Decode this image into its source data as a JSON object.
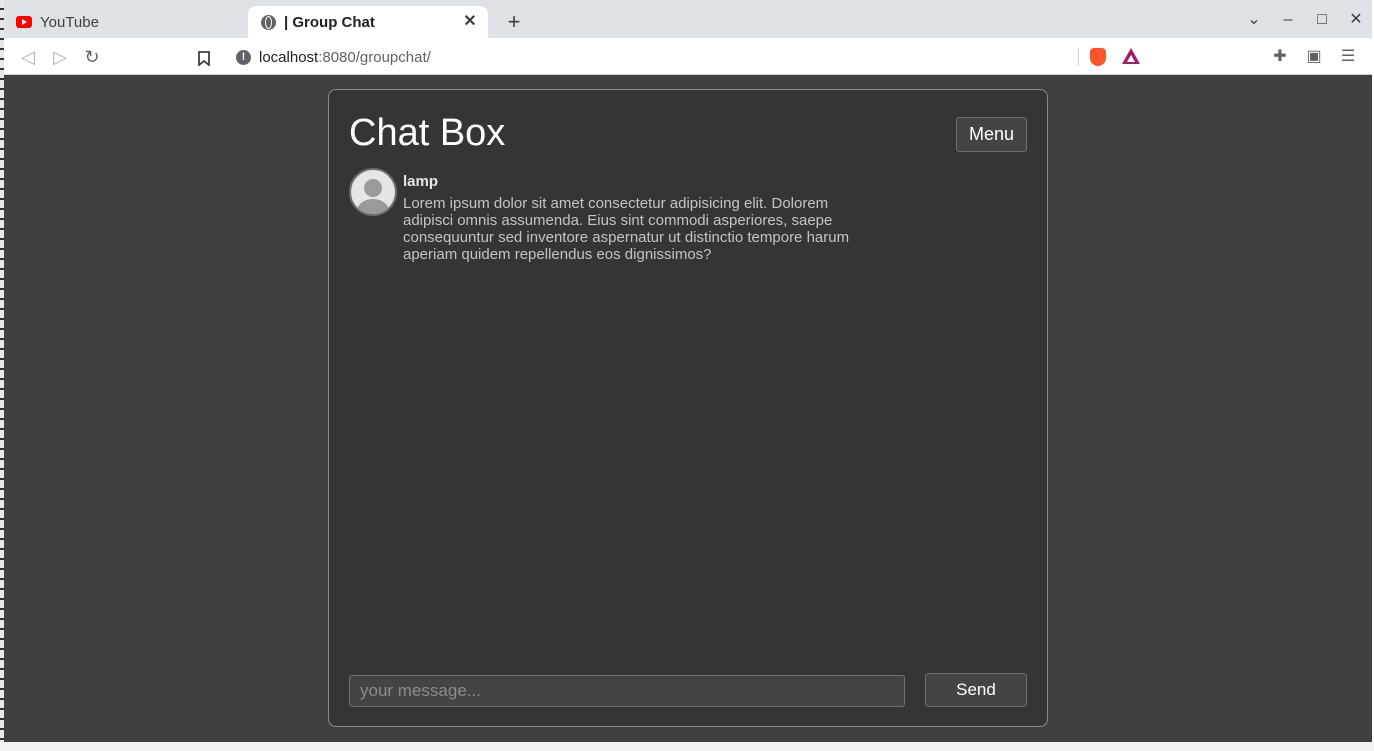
{
  "browser": {
    "tabs": [
      {
        "title": "YouTube",
        "icon": "youtube-icon",
        "active": false
      },
      {
        "title": "| Group Chat",
        "icon": "globe-icon",
        "active": true
      }
    ],
    "url_host": "localhost",
    "url_path": ":8080/groupchat/",
    "tab_close_glyph": "✕",
    "new_tab_glyph": "+",
    "window_controls": {
      "dropdown": "⌄",
      "minimize": "–",
      "maximize": "□",
      "close": "✕"
    },
    "toolbar_glyphs": {
      "back": "◁",
      "forward": "▷",
      "reload": "↻",
      "bookmark": "🔖",
      "info": "!",
      "extensions": "✚",
      "wallet": "▣",
      "menu": "☰"
    }
  },
  "chat": {
    "title": "Chat Box",
    "menu_label": "Menu",
    "messages": [
      {
        "user": "lamp",
        "text": "Lorem ipsum dolor sit amet consectetur adipisicing elit. Dolorem adipisci omnis assumenda. Eius sint commodi asperiores, saepe consequuntur sed inventore aspernatur ut distinctio tempore harum aperiam quidem repellendus eos dignissimos?"
      }
    ],
    "input_placeholder": "your message...",
    "input_value": "",
    "send_label": "Send"
  },
  "colors": {
    "page_bg": "#404040",
    "card_bg": "#353535",
    "card_border": "#8a8a8a",
    "brave_orange": "#fb542b",
    "bat_purple": "#9e1f63"
  }
}
